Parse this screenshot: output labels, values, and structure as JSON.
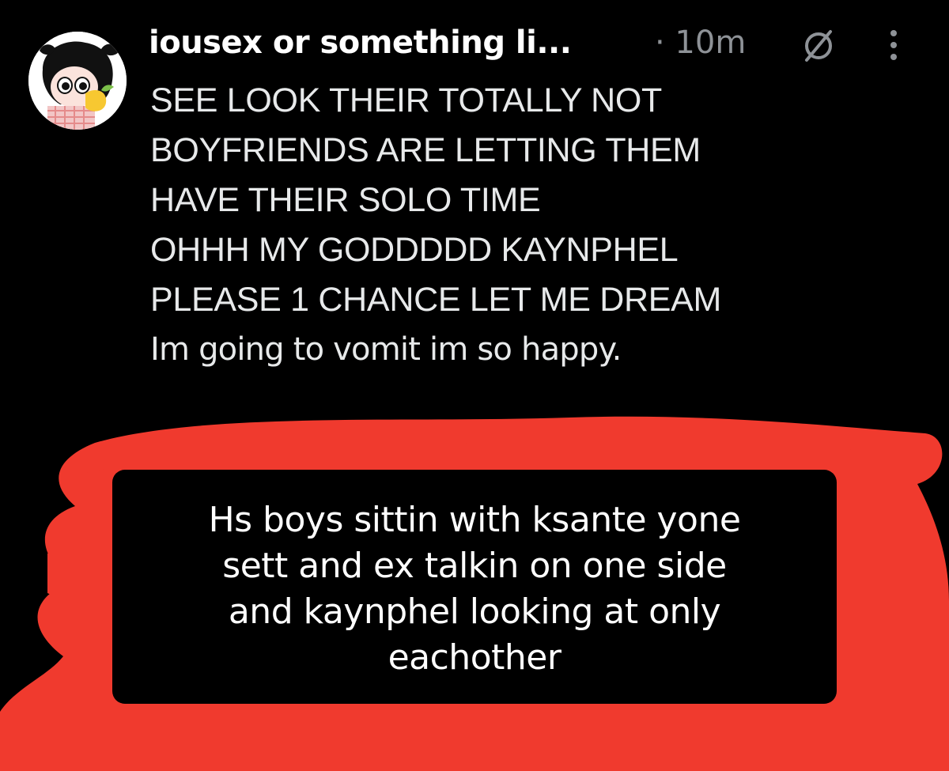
{
  "post": {
    "username": "iousex or something li...",
    "time": "· 10m",
    "muted_icon": "muted-circle-slash-icon",
    "more_icon": "more-vertical-icon",
    "body_lines": [
      "SEE LOOK THEIR TOTALLY NOT",
      "BOYFRIENDS ARE LETTING THEM",
      "HAVE THEIR SOLO TIME",
      "OHHH MY GODDDDD KAYNPHEL",
      "PLEASE 1 CHANCE LET ME DREAM",
      "Im going to vomit im so happy."
    ]
  },
  "overlay": {
    "lines": [
      "Hs boys sittin with ksante yone",
      "sett and ex talkin on one side",
      "and kaynphel looking at only",
      "eachother"
    ]
  },
  "colors": {
    "background": "#000000",
    "scribble": "#f03a2e",
    "muted_text": "#8e9297",
    "text": "#e7e9ea"
  }
}
